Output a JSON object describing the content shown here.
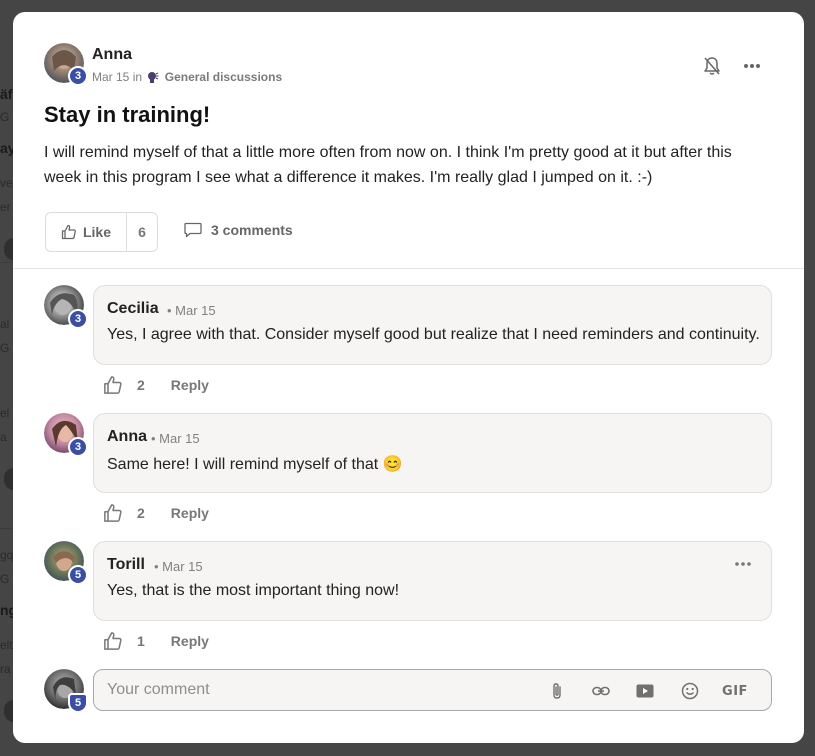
{
  "backdrop": {
    "fragments": [
      "äf",
      "G",
      "ay",
      "ve",
      "er s",
      "al",
      "G",
      "el",
      "a",
      "gq",
      "G",
      "ng",
      "elt",
      "ra"
    ]
  },
  "post": {
    "author": "Anna",
    "level": "3",
    "date": "Mar 15",
    "in_label": "in",
    "category": "General discussions",
    "title": "Stay in training!",
    "body": "I will remind myself of that a little more often from now on. I think I'm pretty good at it but after this week in this program I see what a difference it makes. I'm really glad I jumped on it. :-)",
    "like_label": "Like",
    "like_count": "6",
    "comments_label": "3 comments",
    "icons": {
      "bell": "bell-off-icon",
      "more": "more-horizontal-icon",
      "like": "thumbs-up-icon",
      "comment": "comment-icon",
      "category": "speaking-head-icon"
    }
  },
  "comments": [
    {
      "author": "Cecilia",
      "level": "3",
      "date": "• Mar 15",
      "text": "Yes, I agree with that. Consider myself good but realize that I need reminders and continuity.",
      "likes": "2",
      "reply": "Reply"
    },
    {
      "author": "Anna",
      "level": "3",
      "date": "• Mar 15",
      "text": "Same here! I will remind myself of that",
      "emoji": "😊",
      "likes": "2",
      "reply": "Reply"
    },
    {
      "author": "Torill",
      "level": "5",
      "date": "• Mar 15",
      "text": "Yes, that is the most important thing now!",
      "likes": "1",
      "reply": "Reply"
    }
  ],
  "compose": {
    "level": "5",
    "placeholder": "Your comment",
    "gif_label": "GIF",
    "icons": [
      "paperclip-icon",
      "link-icon",
      "video-icon",
      "emoji-icon",
      "gif-icon"
    ]
  },
  "colors": {
    "badge": "#3a4fa3",
    "bubble": "#f6f5f3",
    "muted": "#808080"
  }
}
